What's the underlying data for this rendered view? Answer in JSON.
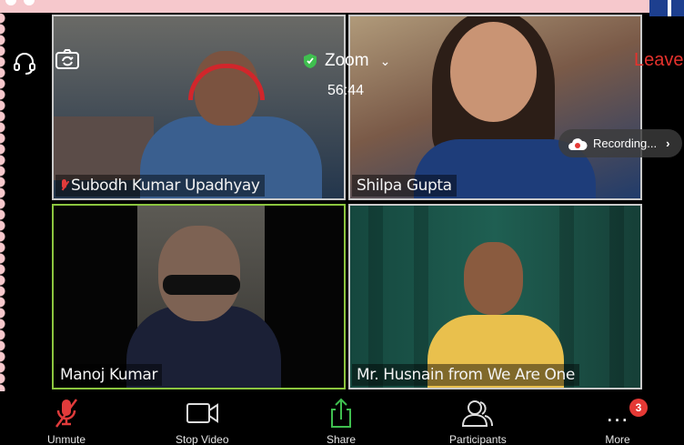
{
  "meeting": {
    "app_title": "Zoom",
    "elapsed": "56:44",
    "leave_label": "Leave",
    "recording_label": "Recording..."
  },
  "participants": [
    {
      "name": "Subodh Kumar Upadhyay",
      "muted": true
    },
    {
      "name": "Shilpa Gupta",
      "muted": false
    },
    {
      "name": "Manoj Kumar",
      "muted": false,
      "active_speaker": true
    },
    {
      "name": "Mr. Husnain from We Are One",
      "muted": false
    }
  ],
  "toolbar": {
    "unmute_label": "Unmute",
    "stop_video_label": "Stop Video",
    "share_label": "Share",
    "participants_label": "Participants",
    "more_label": "More",
    "more_badge": "3"
  },
  "colors": {
    "leave": "#e5322d",
    "active_border": "#8cc63f",
    "share_green": "#3fbf4f",
    "muted_red": "#e03b3b",
    "badge_red": "#e53935"
  },
  "icons": [
    "headset-icon",
    "camera-flip-icon",
    "shield-icon",
    "chevron-down-icon",
    "cloud-icon",
    "mic-muted-icon",
    "video-camera-icon",
    "share-arrow-icon",
    "participants-icon",
    "more-dots-icon"
  ]
}
